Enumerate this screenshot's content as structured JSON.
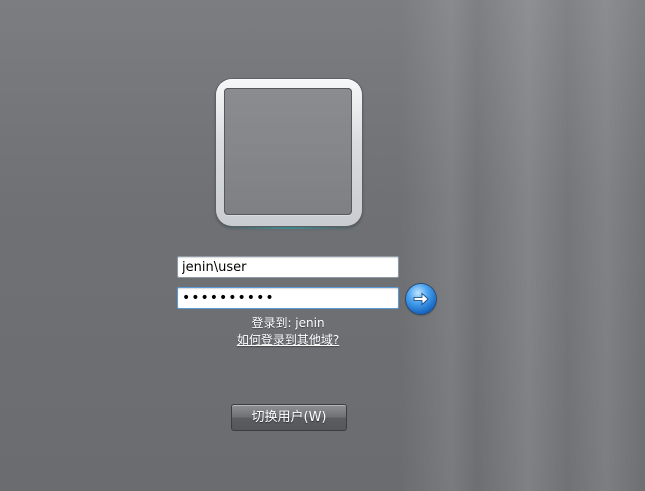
{
  "login": {
    "username_value": "jenin\\user",
    "password_value": "••••••••••",
    "logon_to_text": "登录到: jenin",
    "other_domain_link": "如何登录到其他域?",
    "submit_icon": "arrow-right-icon",
    "switch_user_label": "切换用户(W)"
  },
  "colors": {
    "background": "#6f7175",
    "submit_button": "#1565c0",
    "focus_border": "#5b9bd5"
  }
}
